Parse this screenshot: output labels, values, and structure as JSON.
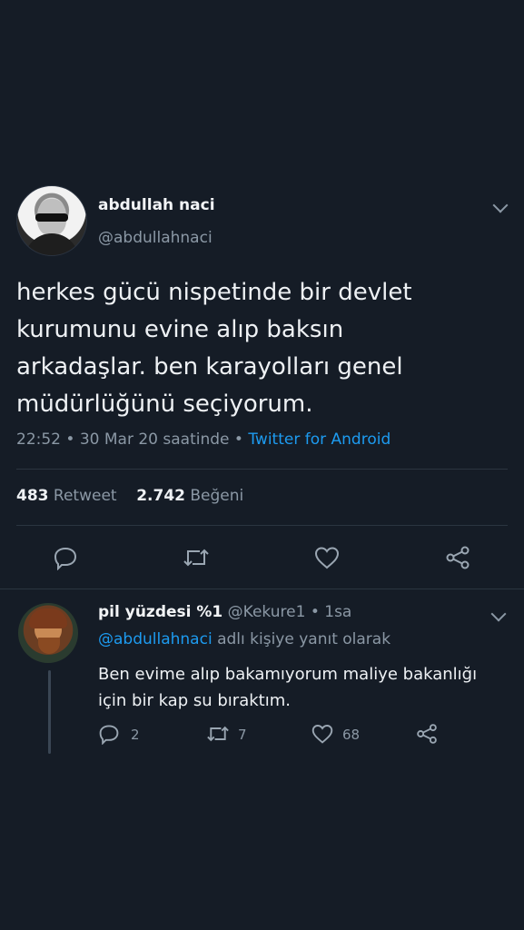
{
  "tweet": {
    "author_name": "abdullah naci",
    "author_handle": "@abdullahnaci",
    "text_lines": [
      "herkes gücü nispetinde bir devlet",
      "kurumunu evine alıp baksın",
      "arkadaşlar. ben karayolları genel",
      "müdürlüğünü seçiyorum."
    ],
    "time": "22:52",
    "date": "30 Mar 20 saatinde",
    "separator": "•",
    "source": "Twitter for Android",
    "retweet_count": "483",
    "retweet_label": "Retweet",
    "like_count": "2.742",
    "like_label": "Beğeni",
    "icons": [
      "reply-icon",
      "retweet-icon",
      "like-icon",
      "share-icon"
    ]
  },
  "reply": {
    "author_name": "pil yüzdesi %1",
    "author_handle": "@Kekure1",
    "time_ago": "1sa",
    "reply_to_mention": "@abdullahnaci",
    "reply_to_suffix": "adlı kişiye yanıt olarak",
    "text_lines": [
      "Ben evime alıp bakamıyorum maliye bakanlığı",
      "için bir kap su bıraktım."
    ],
    "reply_count": "2",
    "retweet_count": "7",
    "like_count": "68"
  },
  "colors": {
    "background": "#151c26",
    "link": "#1d9bf0",
    "muted": "#8b98a5"
  }
}
